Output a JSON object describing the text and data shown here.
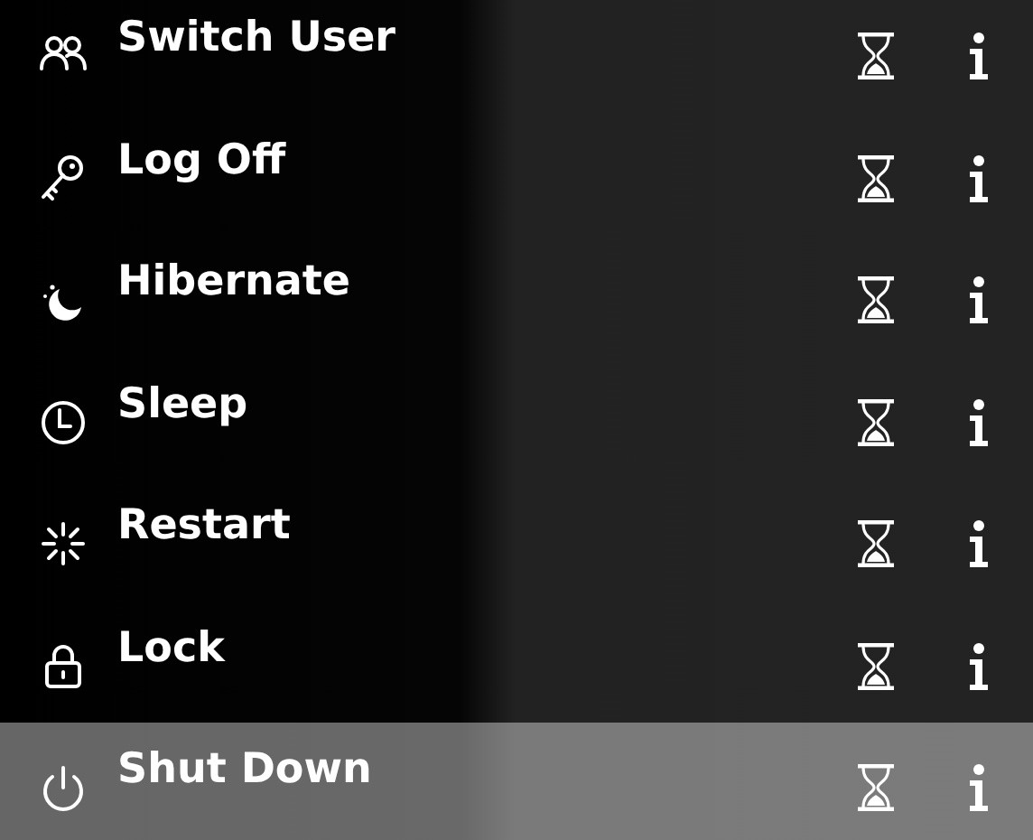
{
  "menu": {
    "items": [
      {
        "label": "Switch User",
        "selected": false
      },
      {
        "label": "Log Off",
        "selected": false
      },
      {
        "label": "Hibernate",
        "selected": false
      },
      {
        "label": "Sleep",
        "selected": false
      },
      {
        "label": "Restart",
        "selected": false
      },
      {
        "label": "Lock",
        "selected": false
      },
      {
        "label": "Shut Down",
        "selected": true
      }
    ]
  }
}
